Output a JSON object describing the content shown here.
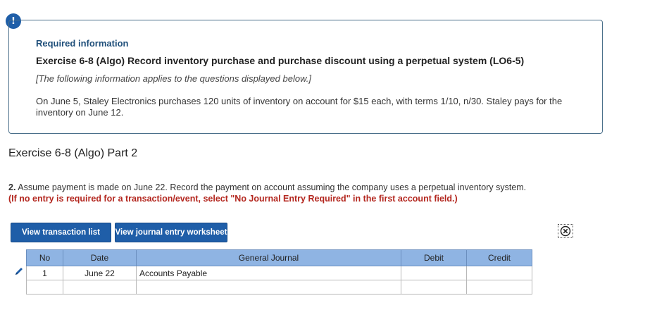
{
  "info": {
    "alert_glyph": "!",
    "required_label": "Required information",
    "exercise_title": "Exercise 6-8 (Algo) Record inventory purchase and purchase discount using a perpetual system (LO6-5)",
    "note": "[The following information applies to the questions displayed below.]",
    "body": "On June 5, Staley Electronics purchases 120 units of inventory on account for $15 each, with terms 1/10, n/30. Staley pays for the inventory on June 12."
  },
  "part_title": "Exercise 6-8 (Algo) Part 2",
  "question": {
    "number": "2.",
    "text": "Assume payment is made on June 22. Record the payment on account assuming the company uses a perpetual inventory system.",
    "instruction": "(If no entry is required for a transaction/event, select \"No Journal Entry Required\" in the first account field.)"
  },
  "buttons": {
    "view_transaction_list": "View transaction list",
    "view_journal_worksheet": "View journal entry worksheet"
  },
  "journal": {
    "headers": [
      "No",
      "Date",
      "General Journal",
      "Debit",
      "Credit"
    ],
    "rows": [
      {
        "no": "1",
        "date": "June 22",
        "account": "Accounts Payable",
        "debit": "",
        "credit": ""
      },
      {
        "no": "",
        "date": "",
        "account": "",
        "debit": "",
        "credit": ""
      }
    ]
  },
  "icons": {
    "alert": "alert-circle-icon",
    "close": "close-circle-icon",
    "edit": "pencil-icon"
  },
  "colors": {
    "accent": "#1f5ea8",
    "header_bg": "#8fb4e3",
    "warning_text": "#b3261e"
  }
}
